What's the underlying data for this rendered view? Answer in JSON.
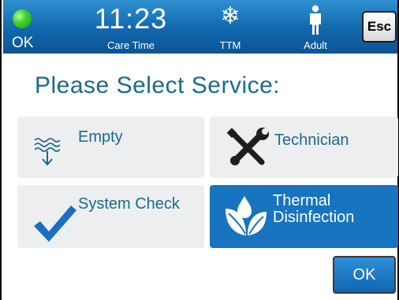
{
  "status_bar": {
    "status": {
      "label": "OK",
      "icon": "status-ok-dot-icon",
      "color": "#43d22e"
    },
    "time": {
      "value": "11:23",
      "label": "Care Time"
    },
    "mode": {
      "label": "TTM",
      "icon": "snowflake-icon"
    },
    "patient": {
      "label": "Adult",
      "icon": "adult-person-icon"
    },
    "esc_label": "Esc"
  },
  "main": {
    "title": "Please Select Service:",
    "services": [
      {
        "label": "Empty",
        "icon": "drain-waves-arrow-icon",
        "selected": false
      },
      {
        "label": "Technician",
        "icon": "wrench-screwdriver-icon",
        "selected": false
      },
      {
        "label": "System Check",
        "icon": "checkmark-icon",
        "selected": false
      },
      {
        "label": "Thermal Disinfection",
        "icon": "water-drop-leaves-icon",
        "selected": true
      }
    ]
  },
  "ok_label": "OK",
  "colors": {
    "header_blue": "#1268ad",
    "accent_teal": "#1a6b8a",
    "selected_tile": "#1874be",
    "tile_bg": "#eceef0"
  }
}
